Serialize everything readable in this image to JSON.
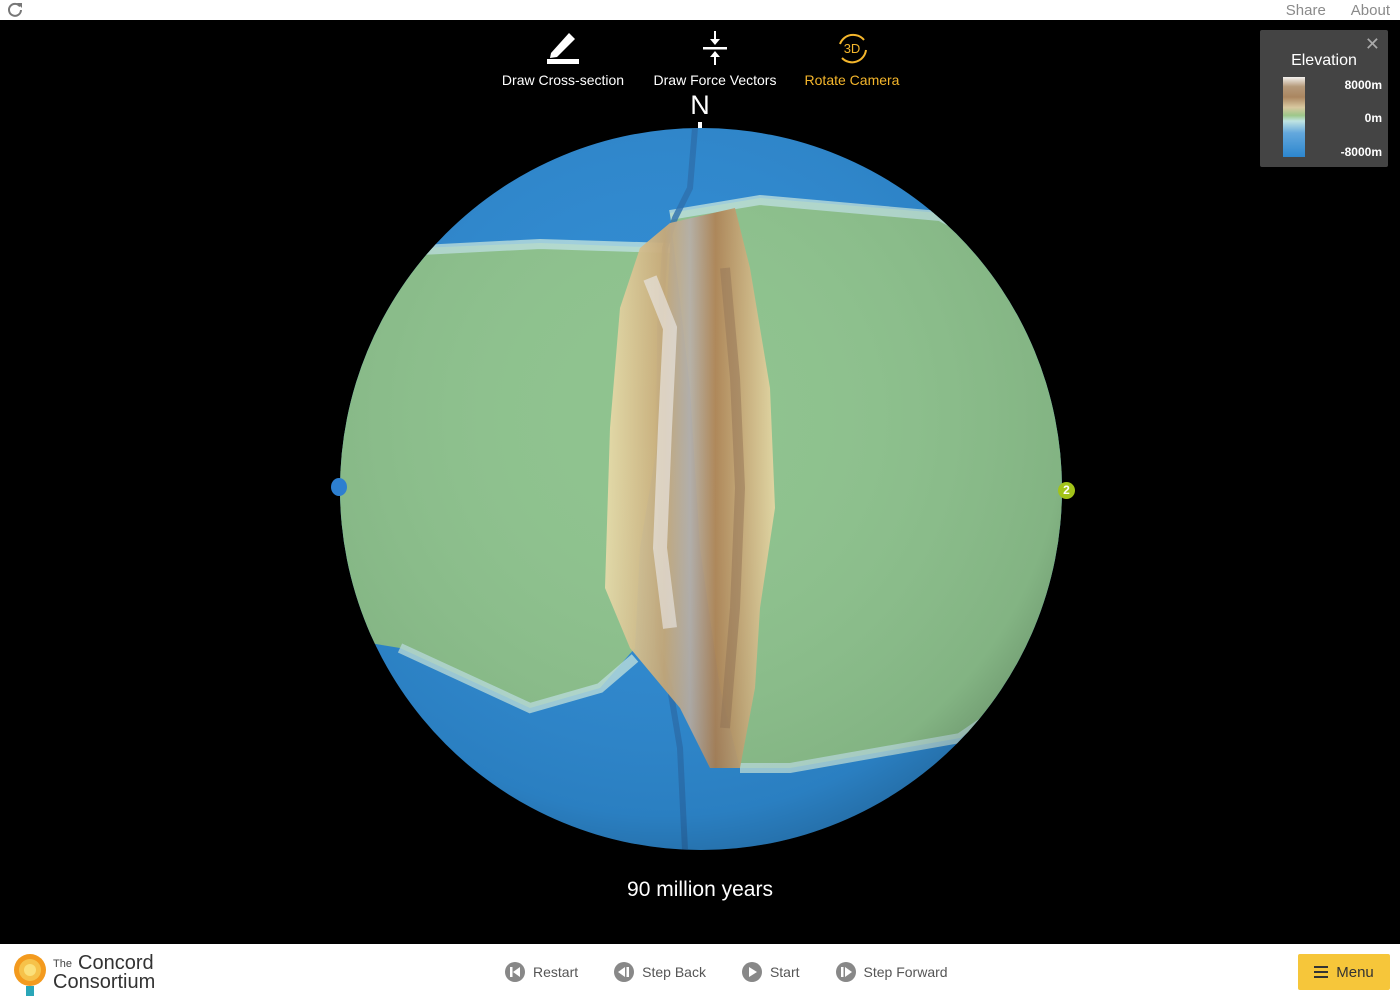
{
  "header": {
    "share_label": "Share",
    "about_label": "About"
  },
  "toolbar": {
    "cross_section_label": "Draw Cross-section",
    "force_vectors_label": "Draw Force Vectors",
    "rotate_camera_label": "Rotate Camera",
    "rotate_icon_text": "3D"
  },
  "compass": {
    "north_label": "N"
  },
  "legend": {
    "title": "Elevation",
    "max_label": "8000m",
    "mid_label": "0m",
    "min_label": "-8000m"
  },
  "globe": {
    "right_marker_label": "2"
  },
  "simulation": {
    "time_label": "90 million years"
  },
  "logo": {
    "line1": "The",
    "line2": "Concord",
    "line3": "Consortium"
  },
  "controls": {
    "restart_label": "Restart",
    "step_back_label": "Step Back",
    "start_label": "Start",
    "step_forward_label": "Step Forward",
    "menu_label": "Menu"
  },
  "colors": {
    "accent": "#f4b62c",
    "menu_button": "#f6c63a",
    "ocean": "#2e8ad2",
    "land": "#8ec38e"
  }
}
